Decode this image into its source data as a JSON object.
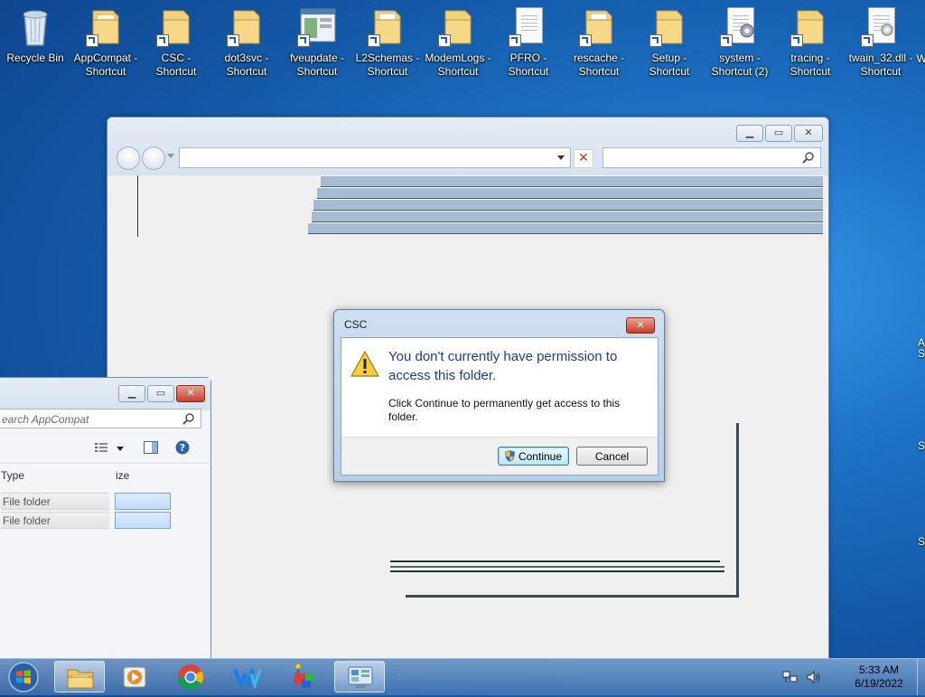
{
  "desktop": {
    "icons": [
      {
        "label": "Recycle Bin",
        "kind": "recycle-bin"
      },
      {
        "label": "AppCompat - Shortcut",
        "kind": "folder-shortcut"
      },
      {
        "label": "CSC - Shortcut",
        "kind": "folder-shortcut"
      },
      {
        "label": "dot3svc - Shortcut",
        "kind": "folder-shortcut"
      },
      {
        "label": "fveupdate - Shortcut",
        "kind": "app-shortcut"
      },
      {
        "label": "L2Schemas - Shortcut",
        "kind": "folder-shortcut"
      },
      {
        "label": "ModemLogs - Shortcut",
        "kind": "folder-shortcut"
      },
      {
        "label": "PFRO - Shortcut",
        "kind": "document-shortcut"
      },
      {
        "label": "rescache - Shortcut",
        "kind": "folder-shortcut"
      },
      {
        "label": "Setup - Shortcut",
        "kind": "folder-shortcut"
      },
      {
        "label": "system - Shortcut (2)",
        "kind": "settings-shortcut"
      },
      {
        "label": "tracing - Shortcut",
        "kind": "folder-shortcut"
      },
      {
        "label": "twain_32.dll - Shortcut",
        "kind": "dll-shortcut"
      }
    ],
    "edge_fragments": [
      "W",
      "A",
      "S",
      "S",
      "S"
    ]
  },
  "small_window": {
    "search_placeholder": "earch AppCompat",
    "columns": {
      "type": "Type",
      "size": "ize"
    },
    "rows": [
      {
        "type": "File folder"
      },
      {
        "type": "File folder"
      }
    ]
  },
  "dialog": {
    "title": "CSC",
    "close_label": "✕",
    "main_instruction": "You don't currently have permission to access this folder.",
    "content": "Click Continue to permanently get access to this folder.",
    "continue_label": "Continue",
    "cancel_label": "Cancel",
    "accent_color": "#1c3b9c"
  },
  "taskbar": {
    "items": [
      {
        "name": "windows-explorer",
        "active": true
      },
      {
        "name": "media-player",
        "active": false
      },
      {
        "name": "chrome",
        "active": false
      },
      {
        "name": "wps",
        "active": false
      },
      {
        "name": "paint-3d",
        "active": false
      },
      {
        "name": "control-panel",
        "active": true
      }
    ],
    "clock_time": "5:33 AM",
    "clock_date": "6/19/2022"
  }
}
